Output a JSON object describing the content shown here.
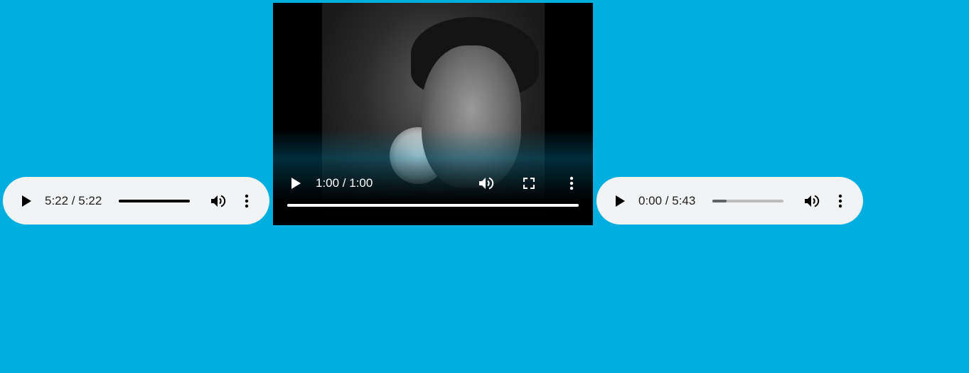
{
  "colors": {
    "page_background": "#00aee0",
    "player_background": "#f1f3f4"
  },
  "audio_players": [
    {
      "time": "5:22 / 5:22",
      "progress": 1.0,
      "icons": [
        "play-icon",
        "volume-icon",
        "more-options-icon"
      ]
    },
    {
      "time": "0:00 / 5:43",
      "progress": 0.2,
      "icons": [
        "play-icon",
        "volume-icon",
        "more-options-icon"
      ]
    }
  ],
  "video_player": {
    "time": "1:00 / 1:00",
    "progress": 1.0,
    "icons": [
      "play-icon",
      "volume-icon",
      "fullscreen-icon",
      "more-options-icon"
    ]
  }
}
